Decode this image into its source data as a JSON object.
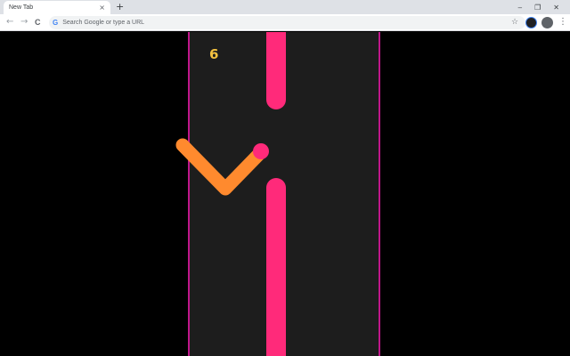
{
  "browser": {
    "tab_title": "New Tab",
    "tab_close": "×",
    "new_tab": "+",
    "window_minimize": "–",
    "window_restore": "❐",
    "window_close": "✕",
    "back": "←",
    "forward": "→",
    "reload": "C",
    "google_g": "G",
    "omnibox_placeholder": "Search Google or type a URL",
    "star": "☆",
    "menu": "⋮"
  },
  "game": {
    "score": "6",
    "colors": {
      "background": "#000000",
      "arena": "#1d1d1d",
      "arena_border": "#c0168a",
      "pillar": "#ff2a7a",
      "snake_body": "#ff8a2e",
      "snake_head": "#ff2a7a",
      "score": "#f4c240"
    }
  }
}
